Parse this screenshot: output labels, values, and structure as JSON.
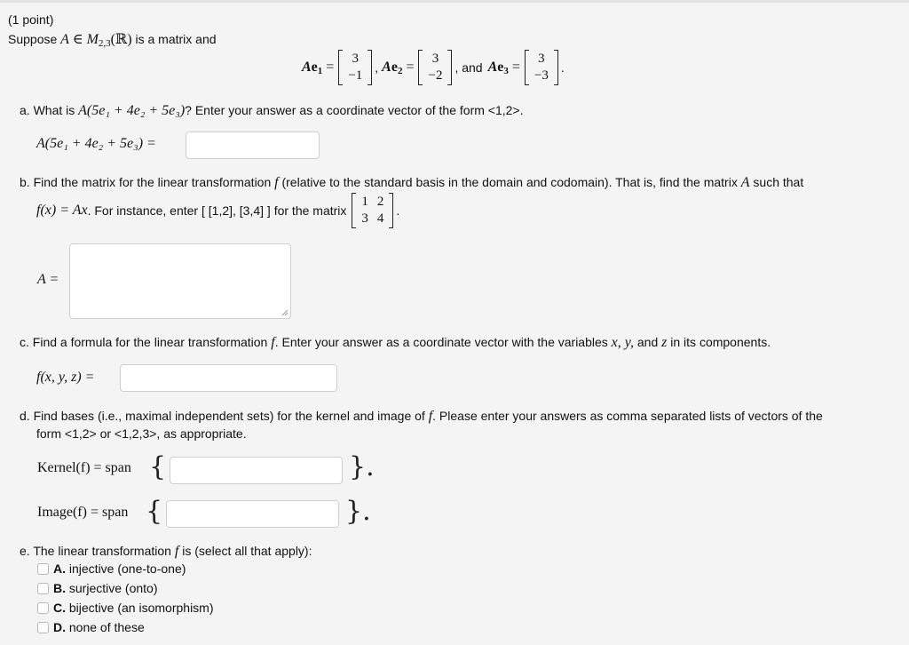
{
  "header": {
    "points": "(1 point)",
    "intro_prefix": "Suppose",
    "intro_A": "A",
    "intro_in": "∈",
    "intro_M": "M",
    "intro_M_sub": "2,3",
    "intro_R": "(ℝ)",
    "intro_suffix": "is a matrix and"
  },
  "givens": [
    {
      "label_A": "A",
      "label_e": "e",
      "sub": "1",
      "top": "3",
      "bottom": "−1",
      "after": ","
    },
    {
      "label_A": "A",
      "label_e": "e",
      "sub": "2",
      "top": "3",
      "bottom": "−2",
      "after": ", and"
    },
    {
      "label_A": "A",
      "label_e": "e",
      "sub": "3",
      "top": "3",
      "bottom": "−3",
      "after": "."
    }
  ],
  "parts": {
    "a": {
      "letter": "a.",
      "q_prefix": "What is",
      "expr": "A(5e₁ + 4e₂ + 5e₃)",
      "q_suffix": "? Enter your answer as a coordinate vector of the form <1,2>.",
      "answer_label": "A(5e₁ + 4e₂ + 5e₃) =",
      "answer_value": ""
    },
    "b": {
      "letter": "b.",
      "line1_prefix": "Find the matrix for the linear transformation",
      "f": "f",
      "line1_mid": "(relative to the standard basis in the domain and codomain). That is, find the matrix",
      "A": "A",
      "line1_suffix": "such that",
      "line2_expr": "f(x) = Ax",
      "line2_text": ". For instance, enter [ [1,2], [3,4] ] for the matrix",
      "example_matrix": [
        [
          "1",
          "2"
        ],
        [
          "3",
          "4"
        ]
      ],
      "period": ".",
      "answer_label": "A =",
      "answer_value": ""
    },
    "c": {
      "letter": "c.",
      "q_prefix": "Find a formula for the linear transformation",
      "f": "f",
      "q_mid": ". Enter your answer as a coordinate vector with the variables",
      "vars": "x, y,",
      "and": "and",
      "z": "z",
      "q_suffix": "in its components.",
      "answer_label": "f(x, y, z) =",
      "answer_value": ""
    },
    "d": {
      "letter": "d.",
      "line1_prefix": "Find bases (i.e., maximal independent sets) for the kernel and image of",
      "f": "f",
      "line1_suffix": ". Please enter your answers as comma separated lists of vectors of the",
      "line2": "form <1,2> or <1,2,3>, as appropriate.",
      "kernel_label": "Kernel(f) = span",
      "image_label": "Image(f) = span",
      "open_brace": "{",
      "close_brace": "}.",
      "kernel_value": "",
      "image_value": ""
    },
    "e": {
      "letter": "e.",
      "q_prefix": "The linear transformation",
      "f": "f",
      "q_suffix": "is (select all that apply):",
      "options": [
        {
          "key": "A.",
          "label": "injective (one-to-one)",
          "checked": false
        },
        {
          "key": "B.",
          "label": "surjective (onto)",
          "checked": false
        },
        {
          "key": "C.",
          "label": "bijective (an isomorphism)",
          "checked": false
        },
        {
          "key": "D.",
          "label": "none of these",
          "checked": false
        }
      ]
    }
  }
}
